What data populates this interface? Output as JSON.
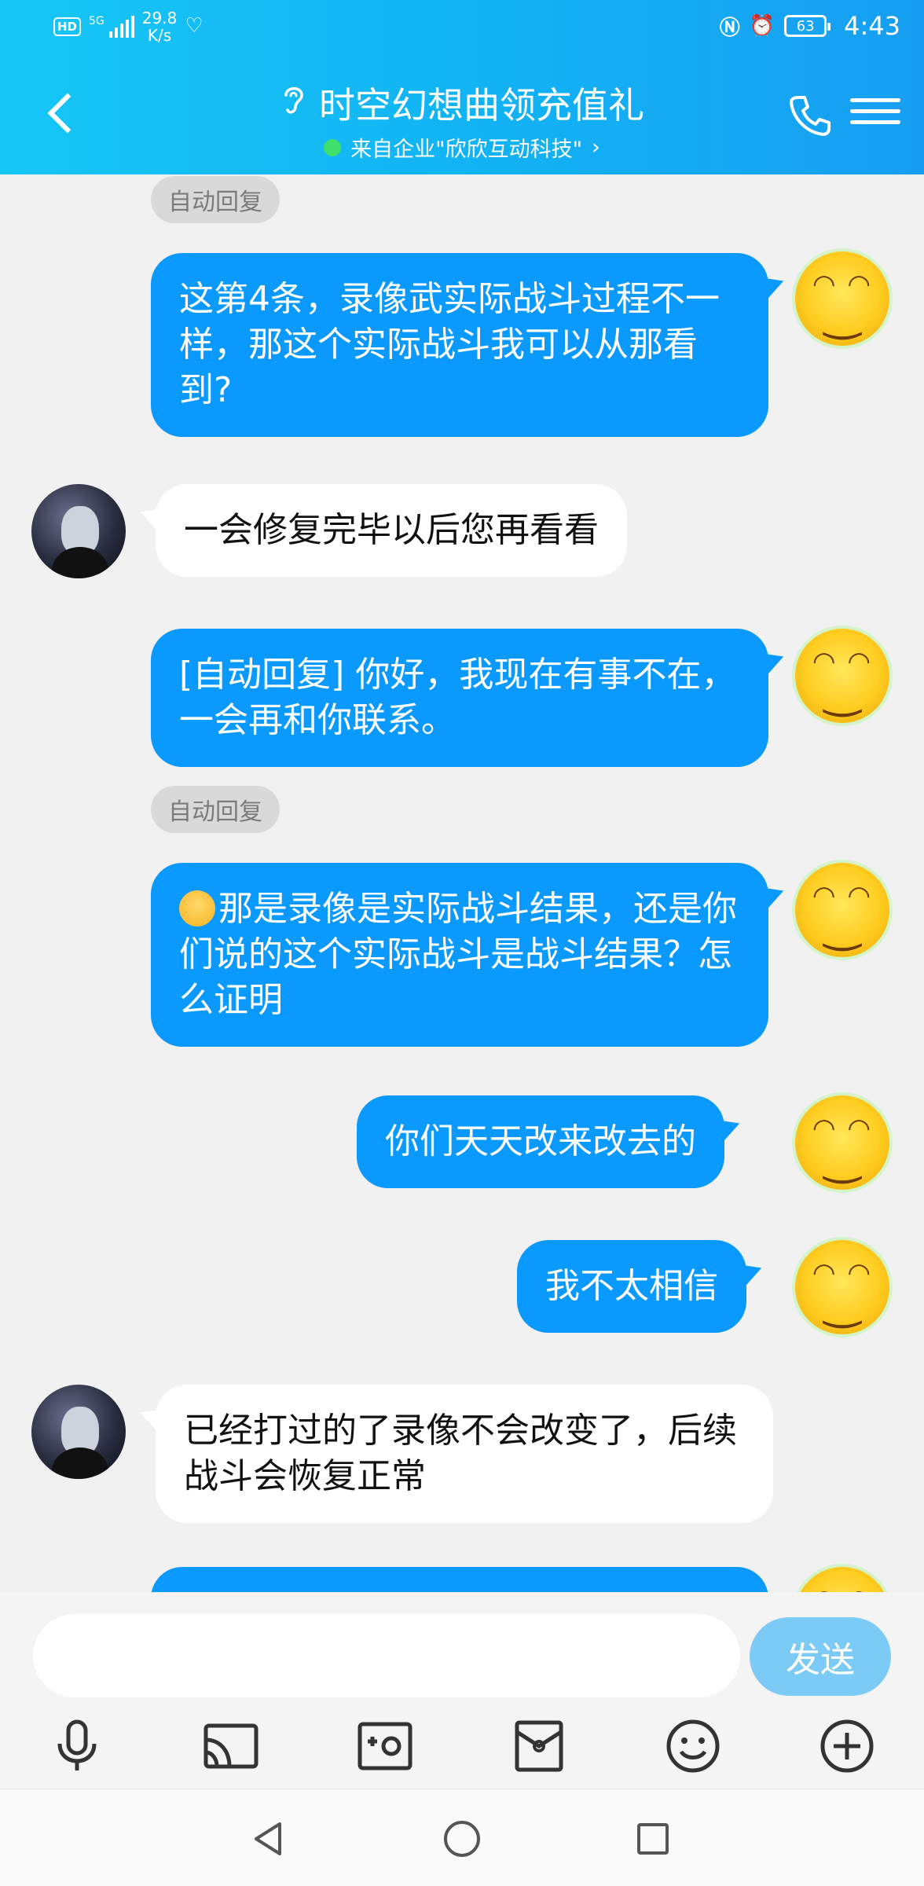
{
  "status_bar": {
    "hd": "HD",
    "network": "5G",
    "speed_value": "29.8",
    "speed_unit": "K/s",
    "battery": "63",
    "time": "4:43"
  },
  "header": {
    "title": "时空幻想曲领充值礼",
    "subtitle": "来自企业\"欣欣互动科技\"",
    "subtitle_arrow": "›"
  },
  "messages": [
    {
      "type": "tag",
      "text": "自动回复"
    },
    {
      "type": "out",
      "text": "这第4条，录像武实际战斗过程不一样，那这个实际战斗我可以从那看到?"
    },
    {
      "type": "in",
      "text": "一会修复完毕以后您再看看"
    },
    {
      "type": "out",
      "text": "[自动回复] 你好，我现在有事不在，一会再和你联系。"
    },
    {
      "type": "tag",
      "text": "自动回复"
    },
    {
      "type": "out",
      "text": "那是录像是实际战斗结果，还是你们说的这个实际战斗是战斗结果？怎么证明"
    },
    {
      "type": "out",
      "text": "你们天天改来改去的"
    },
    {
      "type": "out",
      "text": "我不太相信"
    },
    {
      "type": "in",
      "text": "已经打过的了录像不会改变了，后续战斗会恢复正常"
    }
  ],
  "input": {
    "placeholder": "",
    "send_label": "发送"
  },
  "toolbar_icons": [
    "microphone-icon",
    "cast-icon",
    "camera-icon",
    "gift-icon",
    "emoji-icon",
    "plus-icon"
  ],
  "colors": {
    "header_start": "#16c6f5",
    "header_end": "#179ef2",
    "outgoing_bubble": "#0a99ff",
    "incoming_bubble": "#ffffff",
    "send_button": "#7ccaf6",
    "online_dot": "#3ee06a"
  }
}
